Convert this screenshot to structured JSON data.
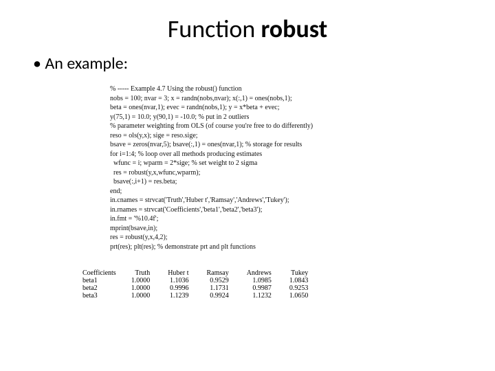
{
  "title": {
    "pre": "Function ",
    "bold": "robust"
  },
  "bullet": "An example:",
  "code": [
    "% ----- Example 4.7 Using the robust() function",
    "nobs = 100; nvar = 3; x = randn(nobs,nvar); x(:,1) = ones(nobs,1);",
    "beta = ones(nvar,1); evec = randn(nobs,1); y = x*beta + evec;",
    "y(75,1) = 10.0; y(90,1) = -10.0; % put in 2 outliers",
    "% parameter weighting from OLS (of course you're free to do differently)",
    "reso = ols(y,x); sige = reso.sige;",
    "bsave = zeros(nvar,5); bsave(:,1) = ones(nvar,1); % storage for results",
    "for i=1:4; % loop over all methods producing estimates",
    "  wfunc = i; wparm = 2*sige; % set weight to 2 sigma",
    "  res = robust(y,x,wfunc,wparm);",
    "  bsave(:,i+1) = res.beta;",
    "end;",
    "in.cnames = strvcat('Truth','Huber t','Ramsay','Andrews','Tukey');",
    "in.rnames = strvcat('Coefficients','beta1','beta2','beta3');",
    "in.fmt = '%10.4f';",
    "mprint(bsave,in);",
    "res = robust(y,x,4,2);",
    "prt(res); plt(res); % demonstrate prt and plt functions"
  ],
  "chart_data": {
    "type": "table",
    "columns": [
      "Coefficients",
      "Truth",
      "Huber t",
      "Ramsay",
      "Andrews",
      "Tukey"
    ],
    "rows": [
      {
        "label": "beta1",
        "values": [
          "1.0000",
          "1.1036",
          "0.9529",
          "1.0985",
          "1.0843"
        ]
      },
      {
        "label": "beta2",
        "values": [
          "1.0000",
          "0.9996",
          "1.1731",
          "0.9987",
          "0.9253"
        ]
      },
      {
        "label": "beta3",
        "values": [
          "1.0000",
          "1.1239",
          "0.9924",
          "1.1232",
          "1.0650"
        ]
      }
    ]
  }
}
